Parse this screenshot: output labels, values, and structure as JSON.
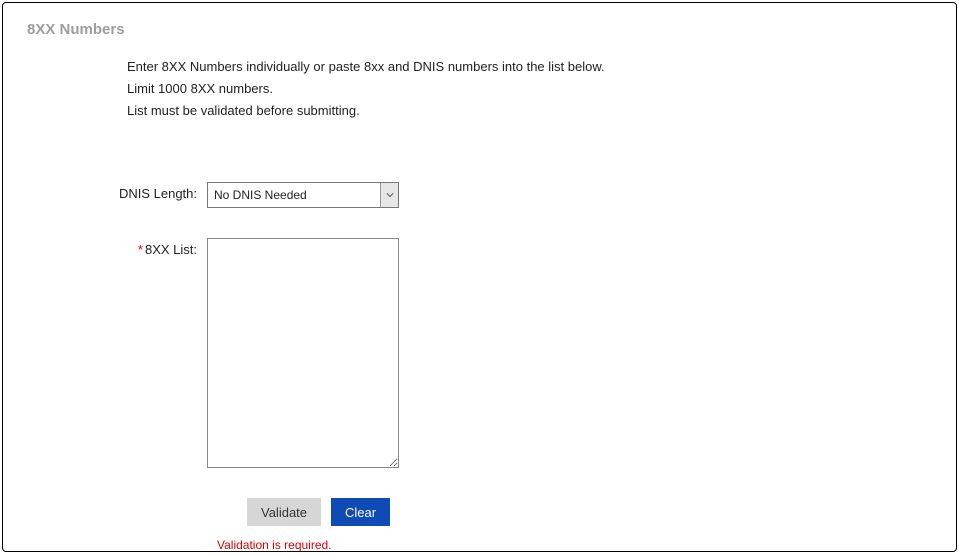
{
  "section_title": "8XX Numbers",
  "instructions": {
    "line1": "Enter 8XX Numbers individually or paste 8xx and DNIS numbers into the list below.",
    "line2": "Limit 1000 8XX numbers.",
    "line3": "List must be validated before submitting."
  },
  "form": {
    "dnis_length_label": "DNIS Length:",
    "dnis_length_value": "No DNIS Needed",
    "list_label": "8XX List:",
    "list_value": ""
  },
  "buttons": {
    "validate": "Validate",
    "clear": "Clear"
  },
  "error": "Validation is required."
}
